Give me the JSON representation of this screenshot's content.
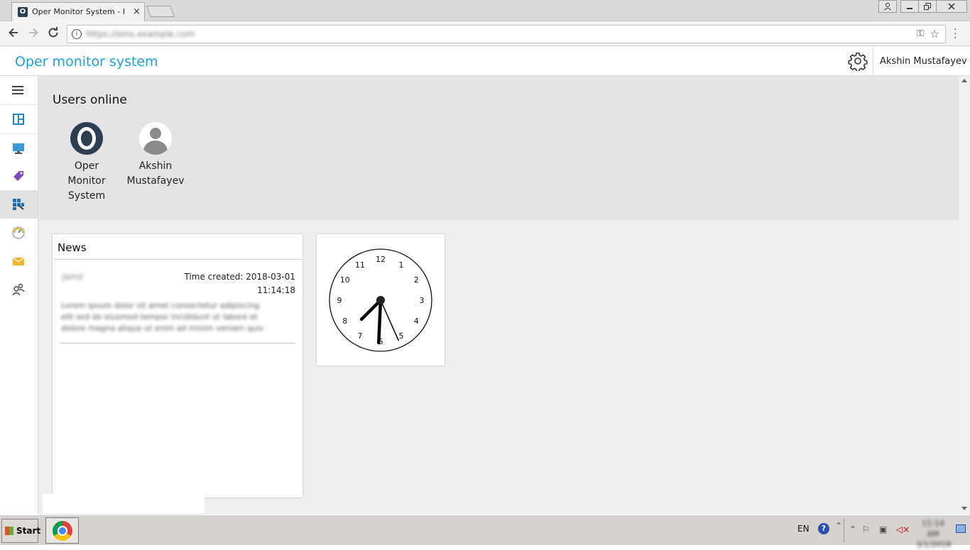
{
  "browser": {
    "tab_title": "Oper Monitor System - Port",
    "tab_close": "×",
    "url": "https://oms.example.com",
    "favicon_text": "O"
  },
  "app": {
    "title": "Oper monitor system",
    "user_name": "Akshin Mustafayev",
    "accent_color": "#1ba1e2"
  },
  "sidebar": {
    "items": [
      {
        "icon": "menu-icon"
      },
      {
        "icon": "dashboard-icon"
      },
      {
        "icon": "monitor-icon"
      },
      {
        "icon": "tag-icon"
      },
      {
        "icon": "apps-grid-icon",
        "active": true
      },
      {
        "icon": "speedometer-icon"
      },
      {
        "icon": "mail-icon"
      },
      {
        "icon": "users-icon"
      }
    ]
  },
  "users_online": {
    "title": "Users online",
    "users": [
      {
        "line1": "Oper",
        "line2": "Monitor",
        "line3": "System"
      },
      {
        "line1": "Akshin",
        "line2": "Mustafayev"
      }
    ]
  },
  "news": {
    "title": "News",
    "author": "Jamil",
    "time_label": "Time created: 2018-03-01",
    "time_value": "11:14:18",
    "body": "Lorem ipsum dolor sit amet consectetur adipiscing elit sed do eiusmod tempor incididunt ut labore et dolore magna aliqua ut enim ad minim veniam quis"
  },
  "clock": {
    "hour": 7,
    "minute": 30,
    "second": 26,
    "numerals": [
      "12",
      "1",
      "2",
      "3",
      "4",
      "5",
      "6",
      "7",
      "8",
      "9",
      "10",
      "11"
    ]
  },
  "taskbar": {
    "start_label": "Start",
    "language": "EN",
    "help": "?",
    "clock_text": "11:14 AM 3/1/2018"
  }
}
